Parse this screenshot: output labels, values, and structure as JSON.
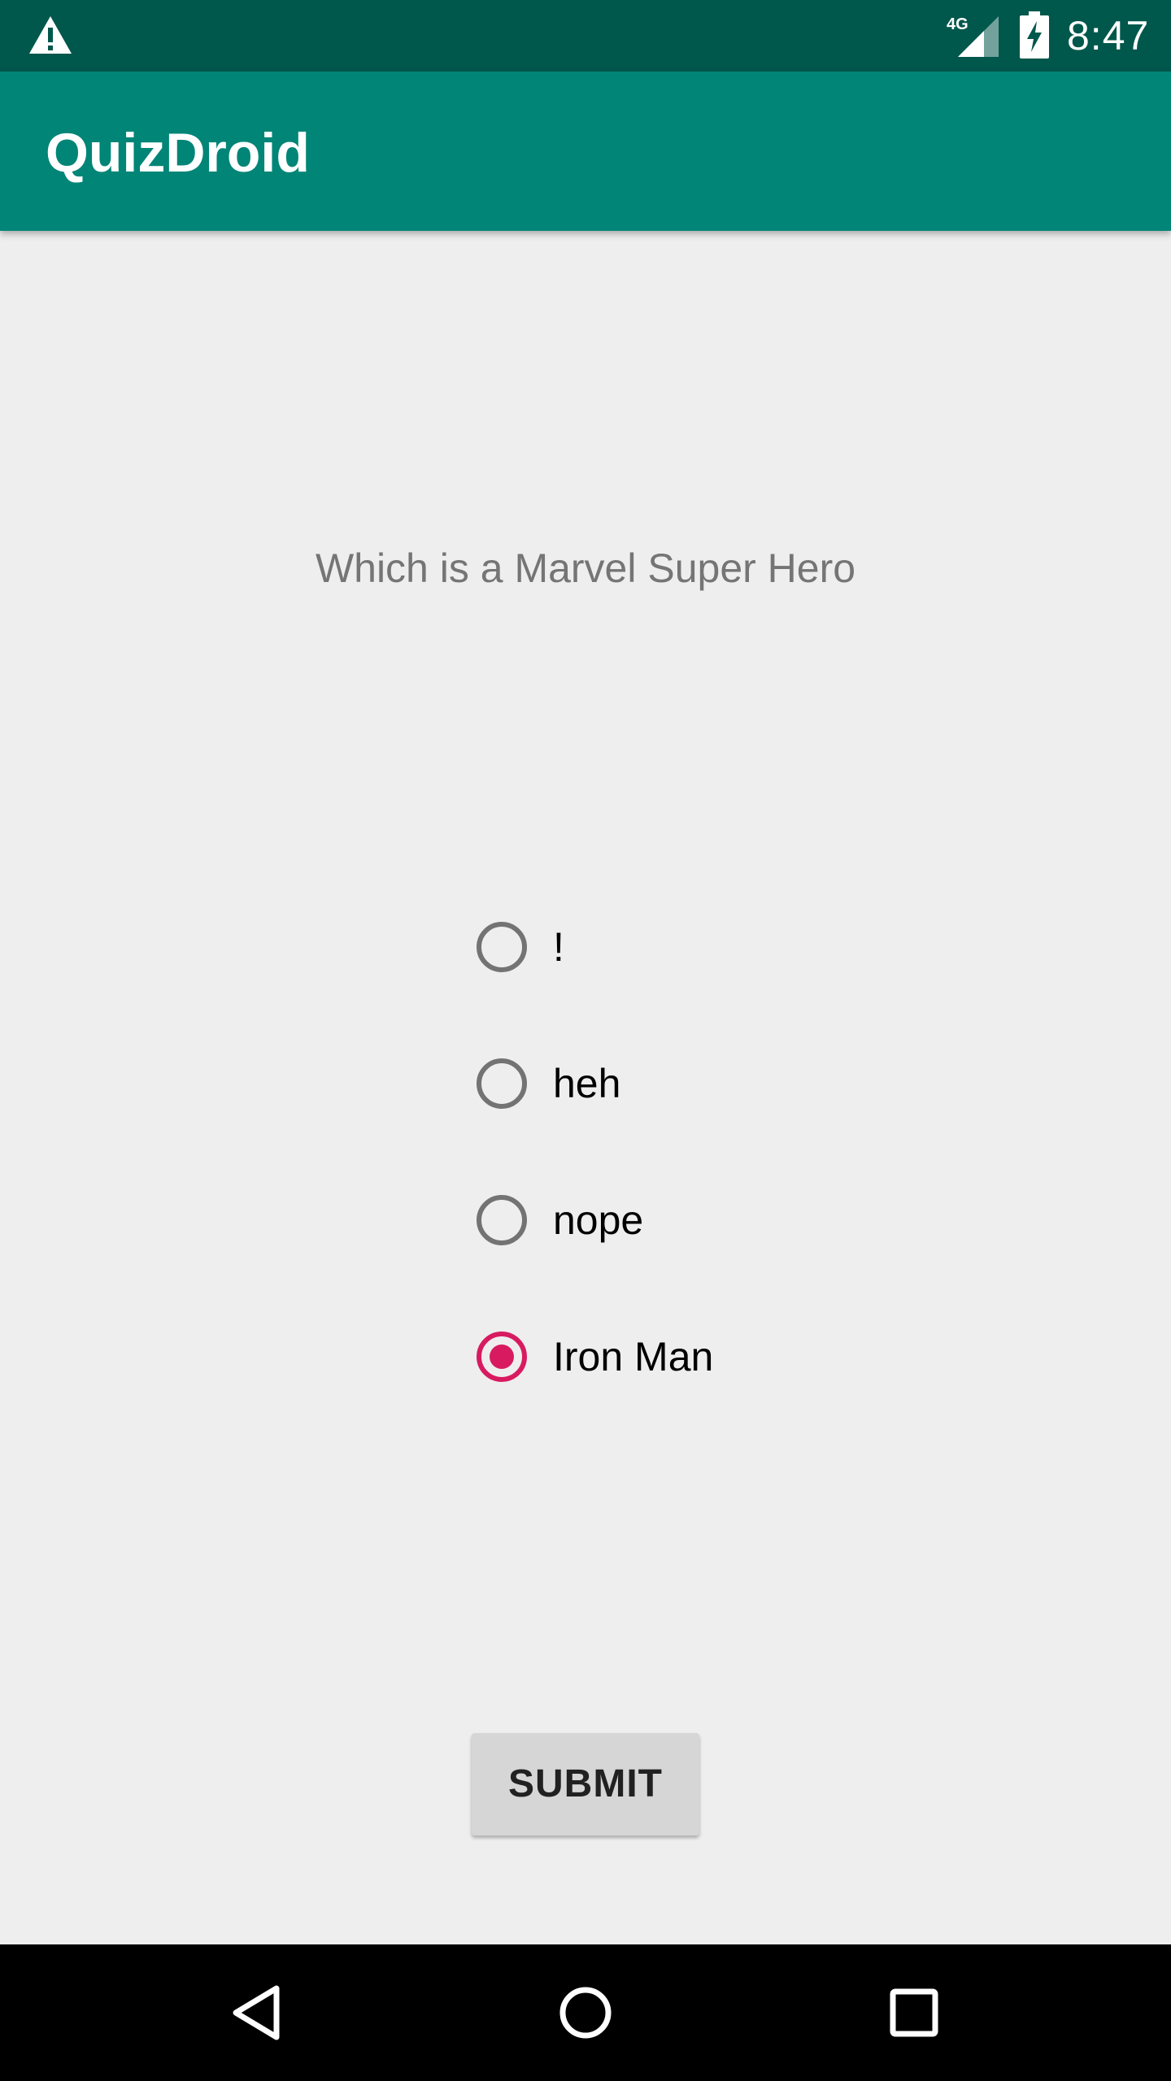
{
  "status_bar": {
    "time": "8:47",
    "network_type": "4G",
    "icons": [
      "alert-icon",
      "signal-4g-icon",
      "battery-charging-icon"
    ]
  },
  "app_bar": {
    "title": "QuizDroid",
    "color": "#008577"
  },
  "quiz": {
    "question": "Which is a Marvel Super Hero",
    "options": [
      {
        "label": "!",
        "checked": false
      },
      {
        "label": "heh",
        "checked": false
      },
      {
        "label": "nope",
        "checked": false
      },
      {
        "label": "Iron Man",
        "checked": true
      }
    ],
    "accent_color": "#d81b60",
    "submit_label": "SUBMIT"
  },
  "nav_bar": {
    "icons": [
      "back-icon",
      "home-icon",
      "recents-icon"
    ]
  }
}
